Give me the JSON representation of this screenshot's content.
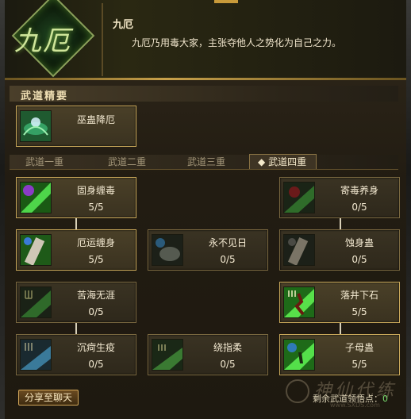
{
  "header": {
    "emblem_text": "九厄",
    "name": "九厄",
    "description": "九厄乃用毒大家，主张夺他人之势化为自己之力。"
  },
  "section_title": "武道精要",
  "core_skill": {
    "name": "巫蛊降厄",
    "icon": "poison-swirl-icon"
  },
  "tabs": [
    "武道一重",
    "武道二重",
    "武道三重",
    "武道四重"
  ],
  "active_tab_marker": "◆",
  "skills": [
    {
      "name": "固身缠毒",
      "level": "5/5",
      "icon": "vine-claw-icon"
    },
    {
      "name": "寄毒养身",
      "level": "0/5",
      "icon": "poison-flower-icon"
    },
    {
      "name": "厄运缠身",
      "level": "5/5",
      "icon": "arm-bind-icon"
    },
    {
      "name": "永不见日",
      "level": "0/5",
      "icon": "dark-orb-icon"
    },
    {
      "name": "蚀身蛊",
      "level": "0/5",
      "icon": "gauntlet-icon"
    },
    {
      "name": "苦海无涯",
      "level": "0/5",
      "icon": "trident-icon"
    },
    {
      "name": "落井下石",
      "level": "5/5",
      "icon": "figure-icon"
    },
    {
      "name": "沉疴生疫",
      "level": "0/5",
      "icon": "trident-slash-icon"
    },
    {
      "name": "绕指柔",
      "level": "0/5",
      "icon": "grass-hand-icon"
    },
    {
      "name": "子母蛊",
      "level": "5/5",
      "icon": "spirit-orb-icon"
    }
  ],
  "share_button": "分享至聊天",
  "remaining_label": "剩余武道领悟点：",
  "remaining_value": "0",
  "watermark": {
    "text": "神仙代练",
    "url": "www.SXDS.com"
  },
  "colors": {
    "accent": "#c9a85a",
    "green_value": "#7be070"
  }
}
